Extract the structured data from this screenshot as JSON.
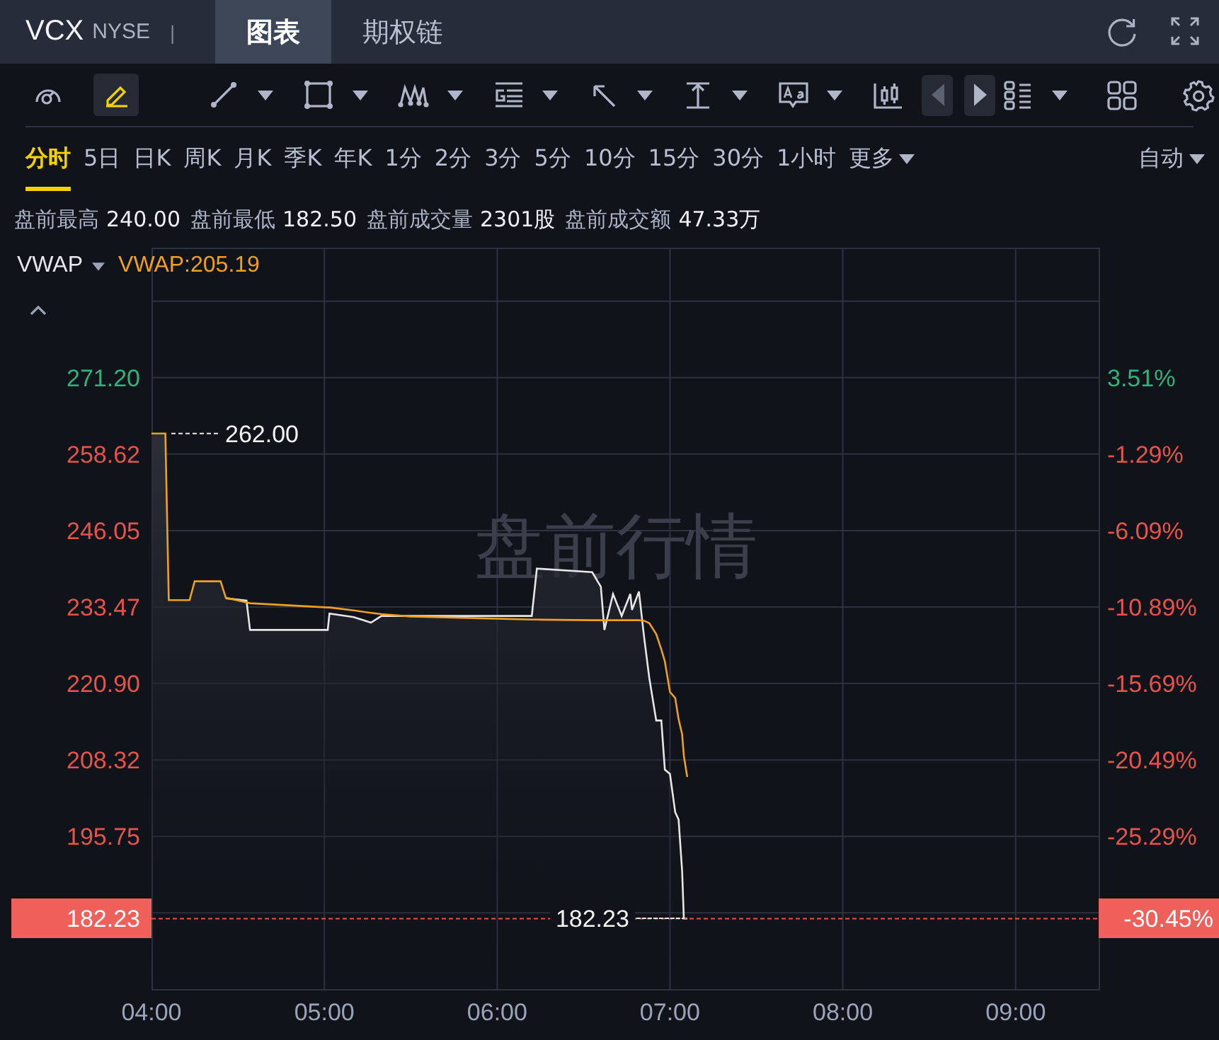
{
  "header": {
    "symbol": "VCX",
    "exchange": "NYSE",
    "separator": "|",
    "tabs": [
      {
        "label": "图表",
        "selected": true
      },
      {
        "label": "期权链",
        "selected": false
      }
    ],
    "actions": [
      {
        "kind": "refresh"
      },
      {
        "kind": "fullscreen"
      }
    ]
  },
  "toolbar": {
    "groups": [
      [
        {
          "kind": "gauge",
          "selected": false,
          "menu": false
        },
        {
          "kind": "pencil",
          "selected": true,
          "menu": false
        }
      ],
      [
        {
          "kind": "line",
          "selected": false,
          "menu": true
        },
        {
          "kind": "rect",
          "selected": false,
          "menu": true
        },
        {
          "kind": "pattern",
          "selected": false,
          "menu": true
        },
        {
          "kind": "fib",
          "selected": false,
          "menu": true
        },
        {
          "kind": "arrow",
          "selected": false,
          "menu": true
        },
        {
          "kind": "ibeam",
          "selected": false,
          "menu": true
        },
        {
          "kind": "text",
          "selected": false,
          "menu": true
        },
        {
          "kind": "candles"
        },
        {
          "kind": "prev",
          "disabled": true
        },
        {
          "kind": "next",
          "disabled": false
        }
      ]
    ],
    "right": [
      {
        "kind": "layout",
        "selected": false,
        "menu": true
      },
      {
        "kind": "grid",
        "selected": false,
        "menu": false
      },
      {
        "kind": "gear",
        "selected": false,
        "menu": false
      }
    ]
  },
  "periods": [
    {
      "label": "分时",
      "selected": true,
      "menu": false
    },
    {
      "label": "5日",
      "selected": false,
      "menu": false
    },
    {
      "label": "日K",
      "selected": false,
      "menu": false
    },
    {
      "label": "周K",
      "selected": false,
      "menu": false
    },
    {
      "label": "月K",
      "selected": false,
      "menu": false
    },
    {
      "label": "季K",
      "selected": false,
      "menu": false
    },
    {
      "label": "年K",
      "selected": false,
      "menu": false
    },
    {
      "label": "1分",
      "selected": false,
      "menu": false
    },
    {
      "label": "2分",
      "selected": false,
      "menu": false
    },
    {
      "label": "3分",
      "selected": false,
      "menu": false
    },
    {
      "label": "5分",
      "selected": false,
      "menu": false
    },
    {
      "label": "10分",
      "selected": false,
      "menu": false
    },
    {
      "label": "15分",
      "selected": false,
      "menu": false
    },
    {
      "label": "30分",
      "selected": false,
      "menu": false
    },
    {
      "label": "1小时",
      "selected": false,
      "menu": false
    },
    {
      "label": "更多",
      "selected": false,
      "menu": true
    }
  ],
  "scale_mode": {
    "label": "自动"
  },
  "stats": [
    {
      "label": "盘前最高",
      "value": "240.00"
    },
    {
      "label": "盘前最低",
      "value": "182.50"
    },
    {
      "label": "盘前成交量",
      "value": "2301股"
    },
    {
      "label": "盘前成交额",
      "value": "47.33万"
    }
  ],
  "indicator": {
    "name": "VWAP",
    "reading": "VWAP:205.19"
  },
  "chart": {
    "watermark": "盘前行情",
    "high": {
      "label": "262.00"
    },
    "last_price": {
      "label": "182.23",
      "point_label": "182.23",
      "pct": "-30.45%"
    },
    "right_ticks": [
      {
        "label": "3.51%",
        "color": "#2fb37a"
      },
      {
        "label": "-1.29%",
        "color": "#e5534b"
      },
      {
        "label": "-6.09%",
        "color": "#e5534b"
      },
      {
        "label": "-10.89%",
        "color": "#e5534b"
      },
      {
        "label": "-15.69%",
        "color": "#e5534b"
      },
      {
        "label": "-20.49%",
        "color": "#e5534b"
      },
      {
        "label": "-25.29%",
        "color": "#e5534b"
      }
    ],
    "chart_data": {
      "type": "line",
      "grid": true,
      "ref_lines": [
        {
          "axis": "y",
          "value": 182.2,
          "color": "#e5534b"
        }
      ],
      "xlim": [
        4,
        9.48
      ],
      "ylim": [
        170.6,
        292.6
      ],
      "xticks": [
        {
          "value": 4,
          "label": "04:00"
        },
        {
          "value": 5,
          "label": "05:00"
        },
        {
          "value": 6,
          "label": "06:00"
        },
        {
          "value": 7,
          "label": "07:00"
        },
        {
          "value": 8,
          "label": "08:00"
        },
        {
          "value": 9,
          "label": "09:00"
        }
      ],
      "yticks": [
        {
          "value": 271.2,
          "label": "271.20"
        },
        {
          "value": 258.62,
          "label": "258.62"
        },
        {
          "value": 246.05,
          "label": "246.05"
        },
        {
          "value": 233.47,
          "label": "233.47"
        },
        {
          "value": 220.9,
          "label": "220.90"
        },
        {
          "value": 208.32,
          "label": "208.32"
        },
        {
          "value": 195.75,
          "label": "195.75"
        }
      ],
      "x": [
        4,
        4.08,
        4.1,
        4.22,
        4.25,
        4.4,
        4.43,
        4.55,
        4.57,
        5.02,
        5.03,
        5.17,
        5.27,
        5.33,
        5.5,
        6.2,
        6.23,
        6.55,
        6.6,
        6.62,
        6.67,
        6.72,
        6.77,
        6.78,
        6.82,
        6.85,
        6.88,
        6.92,
        6.95,
        6.97,
        7,
        7.03,
        7.05,
        7.07,
        7.08,
        7.1
      ],
      "series": [
        {
          "color": "#e6e6e6",
          "values": [
            null,
            null,
            null,
            null,
            null,
            null,
            234.9,
            234.5,
            229.7,
            229.7,
            232.4,
            231.8,
            230.9,
            232,
            232,
            232,
            239.8,
            239.2,
            236.8,
            229.7,
            235.6,
            232,
            235.6,
            233,
            236,
            228.6,
            221.8,
            214.8,
            214.8,
            206.7,
            206,
            199.7,
            198.5,
            190,
            182.2,
            182.2
          ]
        },
        {
          "color": "#f0a020",
          "values": [
            262,
            262,
            234.6,
            234.6,
            237.7,
            237.7,
            235,
            234.2,
            234.1,
            233.4,
            233.4,
            232.9,
            232.5,
            232.3,
            231.9,
            231.4,
            231.4,
            231.3,
            231.3,
            231.3,
            231.3,
            231.3,
            231.3,
            231.3,
            231.3,
            231.2,
            230.8,
            229,
            226.5,
            224.5,
            219.5,
            218.5,
            215,
            212.5,
            209,
            205.5
          ]
        }
      ]
    }
  }
}
